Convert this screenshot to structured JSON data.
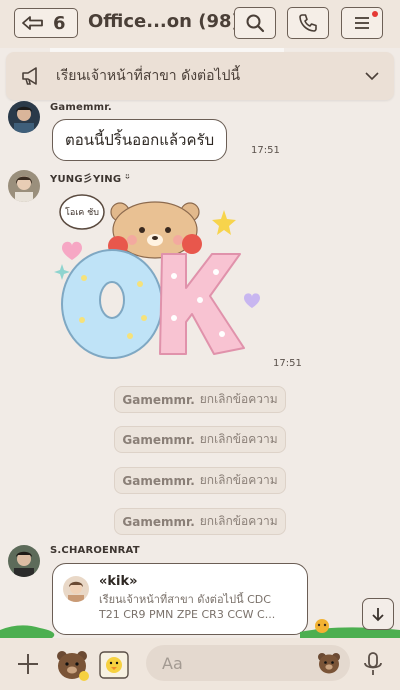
{
  "header": {
    "back_count": "6",
    "title": "Office...on (98)",
    "search_icon": "search-icon",
    "call_icon": "phone-icon",
    "menu_icon": "menu-icon"
  },
  "announcement": {
    "text": "เรียนเจ้าหน้าที่สาขา ดังต่อไปนี้"
  },
  "messages": [
    {
      "sender": "Gamemmr.",
      "text": "ตอนนี้ปริ้นออกแล้วครับ",
      "time": "17:51"
    },
    {
      "sender": "YUNG彡YING ᵕ̈",
      "sticker_text": "โอเค ชับ",
      "sticker_big": "OK",
      "time": "17:51"
    }
  ],
  "deleted_messages": [
    {
      "name": "Gamemmr.",
      "text": "ยกเลิกข้อความ"
    },
    {
      "name": "Gamemmr.",
      "text": "ยกเลิกข้อความ"
    },
    {
      "name": "Gamemmr.",
      "text": "ยกเลิกข้อความ"
    },
    {
      "name": "Gamemmr.",
      "text": "ยกเลิกข้อความ"
    }
  ],
  "reply": {
    "sender": "S.CHAROENRAT",
    "quoted_name": "«kik»",
    "quoted_line1": "เรียนเจ้าหน้าที่สาขา ดังต่อไปนี้ CDC",
    "quoted_line2": "T21 CR9 PMN ZPE CR3 CCW C..."
  },
  "input": {
    "placeholder": "Aa"
  },
  "colors": {
    "background": "#f1ebe6",
    "border": "#6b5e55",
    "accent_red": "#e53935"
  }
}
